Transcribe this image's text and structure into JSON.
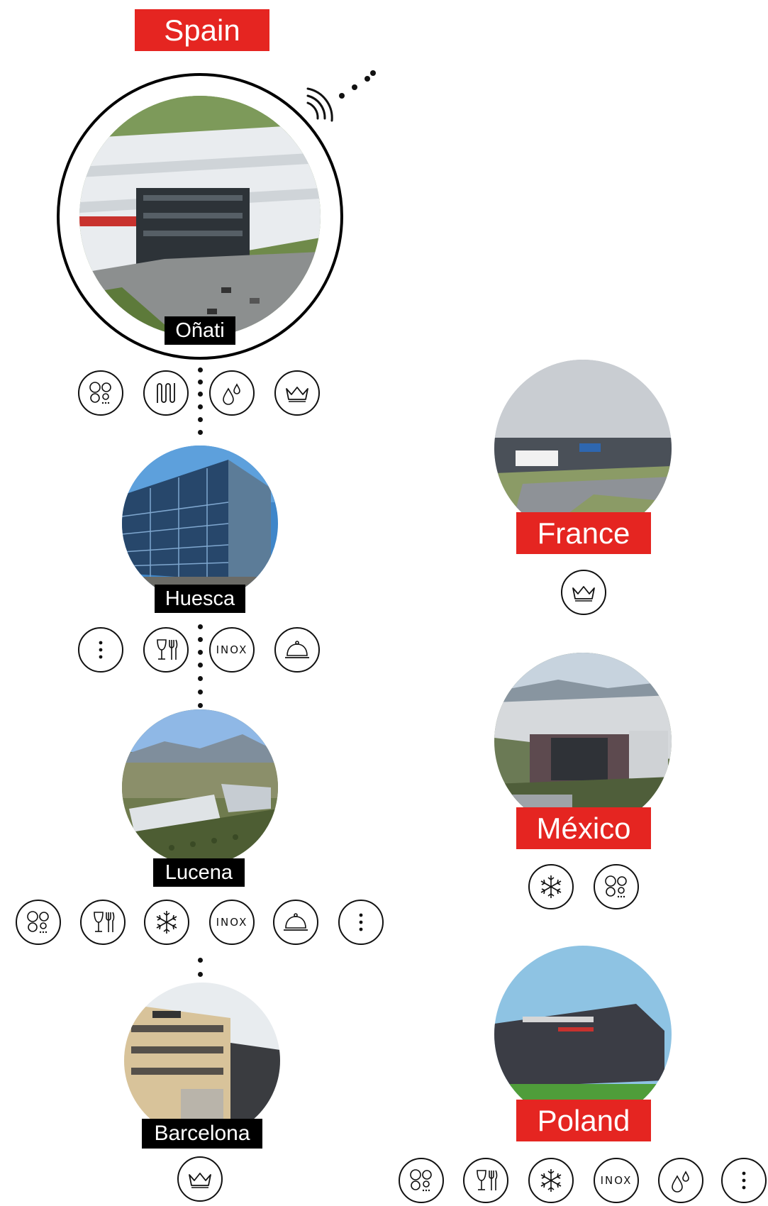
{
  "countries": {
    "spain": "Spain",
    "france": "France",
    "mexico": "México",
    "poland": "Poland"
  },
  "cities": {
    "onati": "Oñati",
    "huesca": "Huesca",
    "lucena": "Lucena",
    "barcelona": "Barcelona"
  },
  "icon_text": {
    "inox": "INOX"
  },
  "colors": {
    "accent_red": "#e52521",
    "label_black": "#000000"
  },
  "icons": {
    "onati": [
      "cooking-rings-icon",
      "heating-element-icon",
      "water-drops-icon",
      "crown-icon"
    ],
    "huesca": [
      "more-options-icon",
      "glass-cutlery-icon",
      "inox-icon",
      "cloche-icon"
    ],
    "lucena": [
      "cooking-rings-icon",
      "glass-cutlery-icon",
      "snowflake-icon",
      "inox-icon",
      "cloche-icon",
      "more-options-icon"
    ],
    "barcelona": [
      "crown-icon"
    ],
    "france": [
      "crown-icon"
    ],
    "mexico": [
      "snowflake-icon",
      "cooking-rings-icon"
    ],
    "poland": [
      "cooking-rings-icon",
      "glass-cutlery-icon",
      "snowflake-icon",
      "inox-icon",
      "water-drops-icon",
      "more-options-icon"
    ]
  }
}
